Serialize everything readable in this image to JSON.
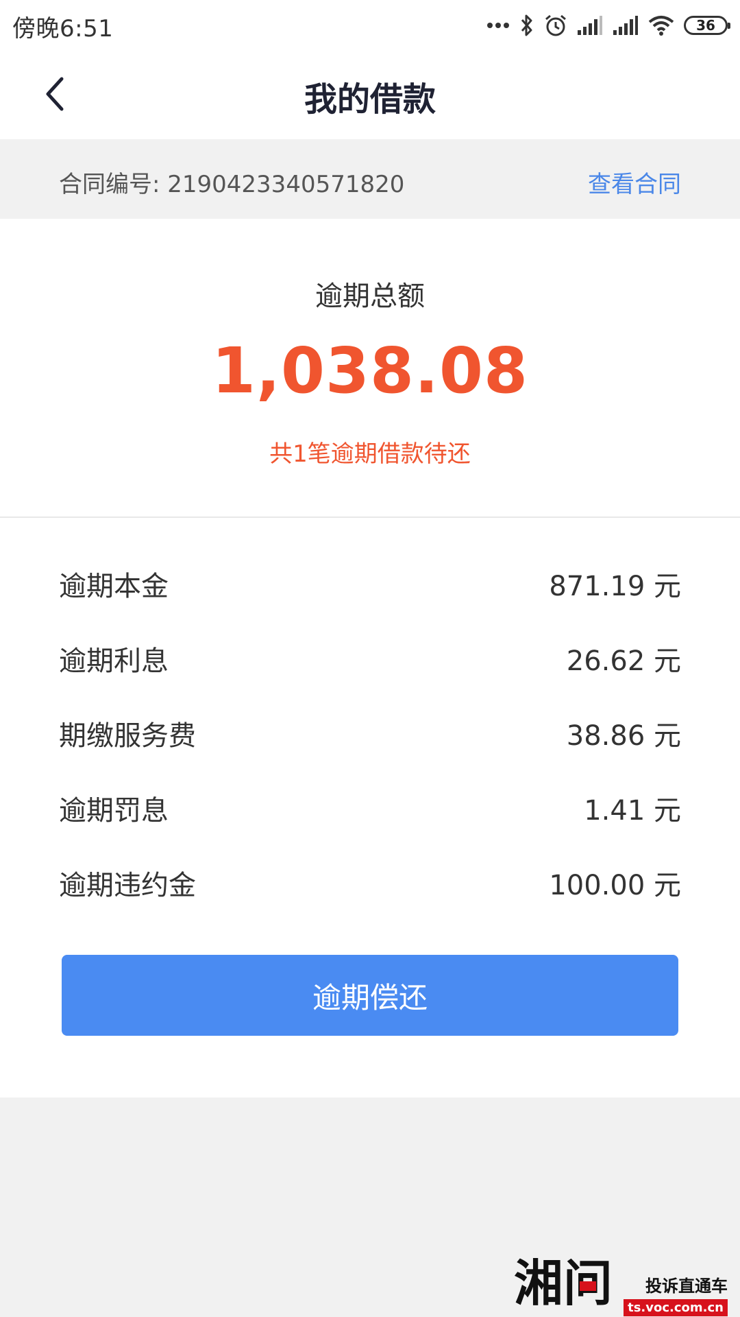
{
  "status_bar": {
    "time": "傍晚6:51",
    "battery": "36",
    "icons": [
      "more-dots-icon",
      "bluetooth-icon",
      "alarm-icon",
      "signal-icon",
      "signal-icon",
      "wifi-icon",
      "battery-icon"
    ]
  },
  "header": {
    "title": "我的借款",
    "back_icon": "back-arrow-icon"
  },
  "contract": {
    "label": "合同编号: 2190423340571820",
    "view_link": "查看合同"
  },
  "summary": {
    "label": "逾期总额",
    "amount": "1,038.08",
    "subtitle": "共1笔逾期借款待还"
  },
  "breakdown": [
    {
      "label": "逾期本金",
      "value": "871.19 元"
    },
    {
      "label": "逾期利息",
      "value": "26.62 元"
    },
    {
      "label": "期缴服务费",
      "value": "38.86 元"
    },
    {
      "label": "逾期罚息",
      "value": "1.41 元"
    },
    {
      "label": "逾期违约金",
      "value": "100.00 元"
    }
  ],
  "actions": {
    "repay_button": "逾期偿还"
  },
  "watermark": {
    "logo": "湘问",
    "title": "投诉直通车",
    "url": "ts.voc.com.cn"
  },
  "colors": {
    "accent_blue": "#4a8bf2",
    "link_blue": "#4a87e8",
    "overdue_red": "#f0552f",
    "background_gray": "#f1f1f1"
  }
}
